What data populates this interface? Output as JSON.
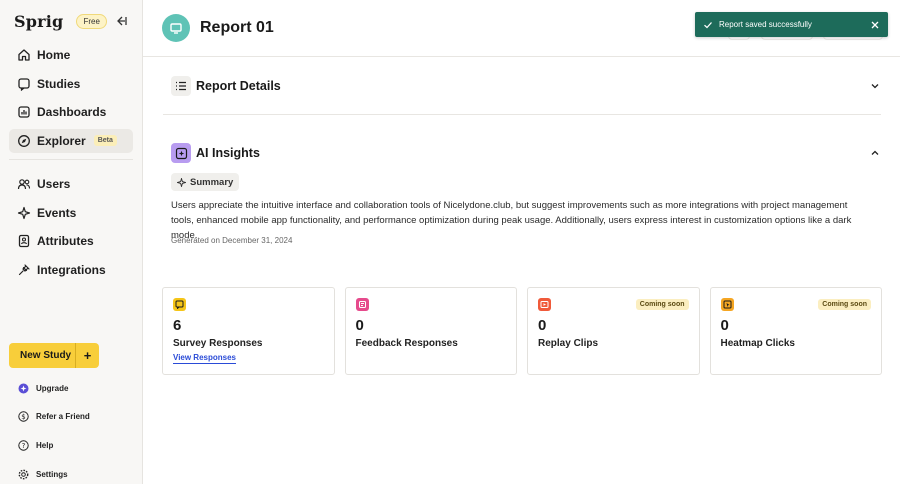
{
  "sidebar": {
    "logo": "Sprig",
    "plan_badge": "Free",
    "nav_primary": [
      {
        "label": "Home"
      },
      {
        "label": "Studies"
      },
      {
        "label": "Dashboards"
      },
      {
        "label": "Explorer",
        "badge": "Beta"
      }
    ],
    "nav_secondary": [
      {
        "label": "Users"
      },
      {
        "label": "Events"
      },
      {
        "label": "Attributes"
      },
      {
        "label": "Integrations"
      }
    ],
    "new_study_label": "New Study",
    "new_study_plus": "+",
    "footer": [
      {
        "label": "Upgrade"
      },
      {
        "label": "Refer a Friend"
      },
      {
        "label": "Help"
      },
      {
        "label": "Settings"
      }
    ]
  },
  "header": {
    "title": "Report 01"
  },
  "toast": {
    "message": "Report saved successfully"
  },
  "report_details": {
    "title": "Report Details"
  },
  "ai_insights": {
    "title": "AI Insights",
    "summary_label": "Summary",
    "text": "Users appreciate the intuitive interface and collaboration tools of Nicelydone.club, but suggest improvements such as more integrations with project management tools, enhanced mobile app functionality, and performance optimization during peak usage. Additionally, users express interest in customization options like a dark mode.",
    "generated": "Generated on December 31, 2024"
  },
  "cards": [
    {
      "value": "6",
      "label": "Survey Responses",
      "link": "View Responses",
      "icon_color": "#f5c518"
    },
    {
      "value": "0",
      "label": "Feedback Responses",
      "icon_color": "#e64a8c"
    },
    {
      "value": "0",
      "label": "Replay Clips",
      "badge": "Coming soon",
      "icon_color": "#f05a3a"
    },
    {
      "value": "0",
      "label": "Heatmap Clicks",
      "badge": "Coming soon",
      "icon_color": "#f5a623"
    }
  ],
  "colors": {
    "accent_yellow": "#f8ce3a",
    "report_icon": "#5fc3b6",
    "toast_bg": "#1d6b5a",
    "ai_icon": "#b89cf0",
    "link": "#2a4bd7"
  }
}
